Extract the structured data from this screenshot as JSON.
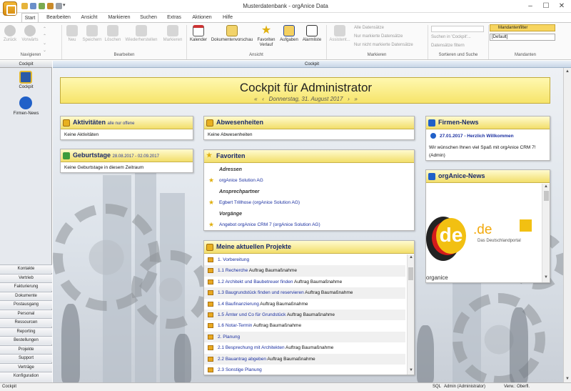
{
  "window": {
    "title": "Musterdatenbank - orgAnice Data",
    "minimize": "–",
    "maximize": "☐",
    "close": "✕"
  },
  "tabs": [
    "Start",
    "Bearbeiten",
    "Ansicht",
    "Markieren",
    "Suchen",
    "Extras",
    "Aktionen",
    "Hilfe"
  ],
  "ribbon": {
    "nav": {
      "back": "Zurück",
      "forward": "Vorwärts",
      "group": "Navigieren"
    },
    "edit": {
      "new": "Neu",
      "save": "Speichern",
      "delete": "Löschen",
      "restore": "Wiederherstellen",
      "mark": "Markieren",
      "group": "Bearbeiten"
    },
    "view": {
      "calendar": "Kalender",
      "docpreview": "Dokumentenvorschau",
      "favorites": "Favoriten",
      "favorites2": "Verlauf",
      "tasks": "Aufgaben",
      "alarm": "Alarmliste",
      "group": "Ansicht"
    },
    "mark": {
      "assistant": "Assistent...",
      "all": "Alle Datensätze",
      "only_marked": "Nur markierte Datensätze",
      "not_marked": "Nur nicht markierte Datensätze",
      "group": "Markieren"
    },
    "sort": {
      "search": "Suchen in 'Cockpit'...",
      "filter": "Datensätze filtern",
      "group": "Sortieren und Suche"
    },
    "mand": {
      "filter": "Mandantenfilter",
      "default": "[Default]",
      "group": "Mandanten"
    }
  },
  "leftpane": {
    "header": "Cockpit",
    "items": [
      "Cockpit",
      "Firmen-News"
    ],
    "nav": [
      "Kontakte",
      "Vertrieb",
      "Fakturierung",
      "Dokumente",
      "Postausgang",
      "Personal",
      "Ressourcen",
      "Reporting",
      "Bestellungen",
      "Projekte",
      "Support",
      "Verträge",
      "Konfiguration"
    ]
  },
  "main": {
    "header": "Cockpit",
    "title": "Cockpit für Administrator",
    "date": "Donnerstag, 31. August 2017",
    "nav_prev2": "«",
    "nav_prev": "‹",
    "nav_next": "›",
    "nav_next2": "»",
    "activities": {
      "title": "Aktivitäten",
      "sub": "alle nur offene",
      "body": "Keine Aktivitäten"
    },
    "birthdays": {
      "title": "Geburtstage",
      "sub": "28.08.2017 - 02.09.2017",
      "body": "Keine Geburtstage in diesem Zeitraum"
    },
    "absences": {
      "title": "Abwesenheiten",
      "body": "Keine Abwesenheiten"
    },
    "favorites": {
      "title": "Favoriten",
      "groups": [
        {
          "label": "Adressen",
          "item": "orgAnice Solution AG"
        },
        {
          "label": "Ansprechpartner",
          "item": "Egbert Trillhose (orgAnice Solution AG)"
        },
        {
          "label": "Vorgänge",
          "item": "Angebot orgAnice CRM 7 (orgAnice Solution AG)"
        }
      ]
    },
    "projects": {
      "title": "Meine aktuellen Projekte",
      "rows": [
        {
          "a": "1. Vorbereitung",
          "b": ""
        },
        {
          "a": "1.1 Recherche",
          "b": "Auftrag Baumaßnahme"
        },
        {
          "a": "1.2 Architekt und Baubetreuer finden",
          "b": "Auftrag Baumaßnahme"
        },
        {
          "a": "1.3 Baugrundstück finden und reservieren",
          "b": "Auftrag Baumaßnahme"
        },
        {
          "a": "1.4 Baufinanzierung",
          "b": "Auftrag Baumaßnahme"
        },
        {
          "a": "1.5 Ämter und Co für Grundstück",
          "b": "Auftrag Baumaßnahme"
        },
        {
          "a": "1.6 Notar-Termin",
          "b": "Auftrag Baumaßnahme"
        },
        {
          "a": "2. Planung",
          "b": ""
        },
        {
          "a": "2.1 Besprechung mit Architekten",
          "b": "Auftrag Baumaßnahme"
        },
        {
          "a": "2.2 Bauantrag abgeben",
          "b": "Auftrag Baumaßnahme"
        },
        {
          "a": "2.3 Sonstige Planung",
          "b": ""
        }
      ]
    },
    "firmennews": {
      "title": "Firmen-News",
      "link": "27.01.2017 - Herzlich Willkommen",
      "body": "Wir wünschen Ihnen viel Spaß mit orgAnice CRM 7! (Admin)"
    },
    "organicenews": {
      "title": "orgAnice-News",
      "logo_de": "de",
      "logo_dot": ".de",
      "logo_sub": "Das Deutschlandportal",
      "footer": "organice"
    }
  },
  "status": {
    "left": "Cockpit",
    "sql": "SQL",
    "user": "Admin (Administrator)",
    "right": "Verw.: Oberfl."
  },
  "colors": {
    "header_yellow": "#f6e46a",
    "link_blue": "#1a2fa0"
  }
}
